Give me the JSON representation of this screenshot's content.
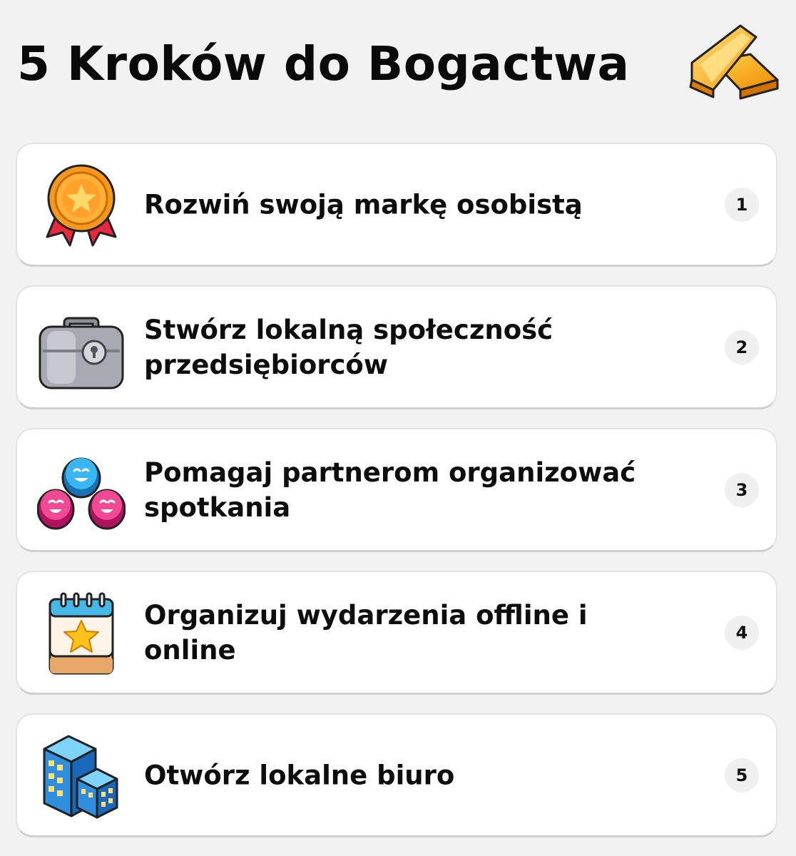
{
  "header": {
    "title": "5 Kroków do Bogactwa",
    "icon": "gold-bars-icon"
  },
  "steps": [
    {
      "number": "1",
      "label": "Rozwiń swoją markę osobistą",
      "icon": "medal-ribbon-icon"
    },
    {
      "number": "2",
      "label": "Stwórz lokalną społeczność przedsiębiorców",
      "icon": "briefcase-icon"
    },
    {
      "number": "3",
      "label": "Pomagaj partnerom organizować spotkania",
      "icon": "people-group-icon"
    },
    {
      "number": "4",
      "label": "Organizuj wydarzenia offline i online",
      "icon": "calendar-star-icon"
    },
    {
      "number": "5",
      "label": "Otwórz lokalne biuro",
      "icon": "office-buildings-icon"
    }
  ],
  "colors": {
    "background": "#f2f2f2",
    "card": "#ffffff",
    "text": "#0d0d0d",
    "badge": "#f0f0f0"
  }
}
